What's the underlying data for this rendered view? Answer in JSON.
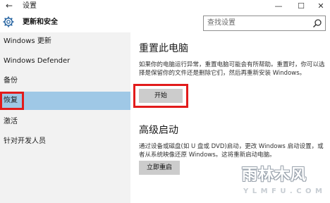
{
  "window": {
    "title": "设置",
    "back_icon": "back-arrow-icon",
    "controls": {
      "minimize": "—",
      "maximize": "☐",
      "close": "✕"
    }
  },
  "header": {
    "section_title": "更新和安全",
    "icon": "gear-icon",
    "search_placeholder": "查找设置",
    "search_icon": "search-icon"
  },
  "sidebar": {
    "items": [
      {
        "label": "Windows 更新"
      },
      {
        "label": "Windows Defender"
      },
      {
        "label": "备份"
      },
      {
        "label": "恢复"
      },
      {
        "label": "激活"
      },
      {
        "label": "针对开发人员"
      }
    ],
    "selected_index": 3,
    "highlight_color": "#9fc8e6"
  },
  "main": {
    "reset": {
      "title": "重置此电脑",
      "description": "如果你的电脑运行异常，重置电脑可能会有所帮助。重置时，你可以选择是保留你的文件还是删除它们，然后再重新安装 Windows。",
      "button": "开始"
    },
    "advanced": {
      "title": "高级启动",
      "description": "通过设备或磁盘(如 U 盘或 DVD)启动，更改 Windows 启动设置，或者从系统映像还原 Windows。这将重新启动电脑。",
      "button": "立即重启"
    }
  },
  "watermark": {
    "text": "雨林木风",
    "url": "Y L M F U . C O M"
  },
  "colors": {
    "annotation_red": "#e21b1b",
    "sidebar_bg": "#f2f2f2",
    "button_bg": "#cccccc"
  }
}
